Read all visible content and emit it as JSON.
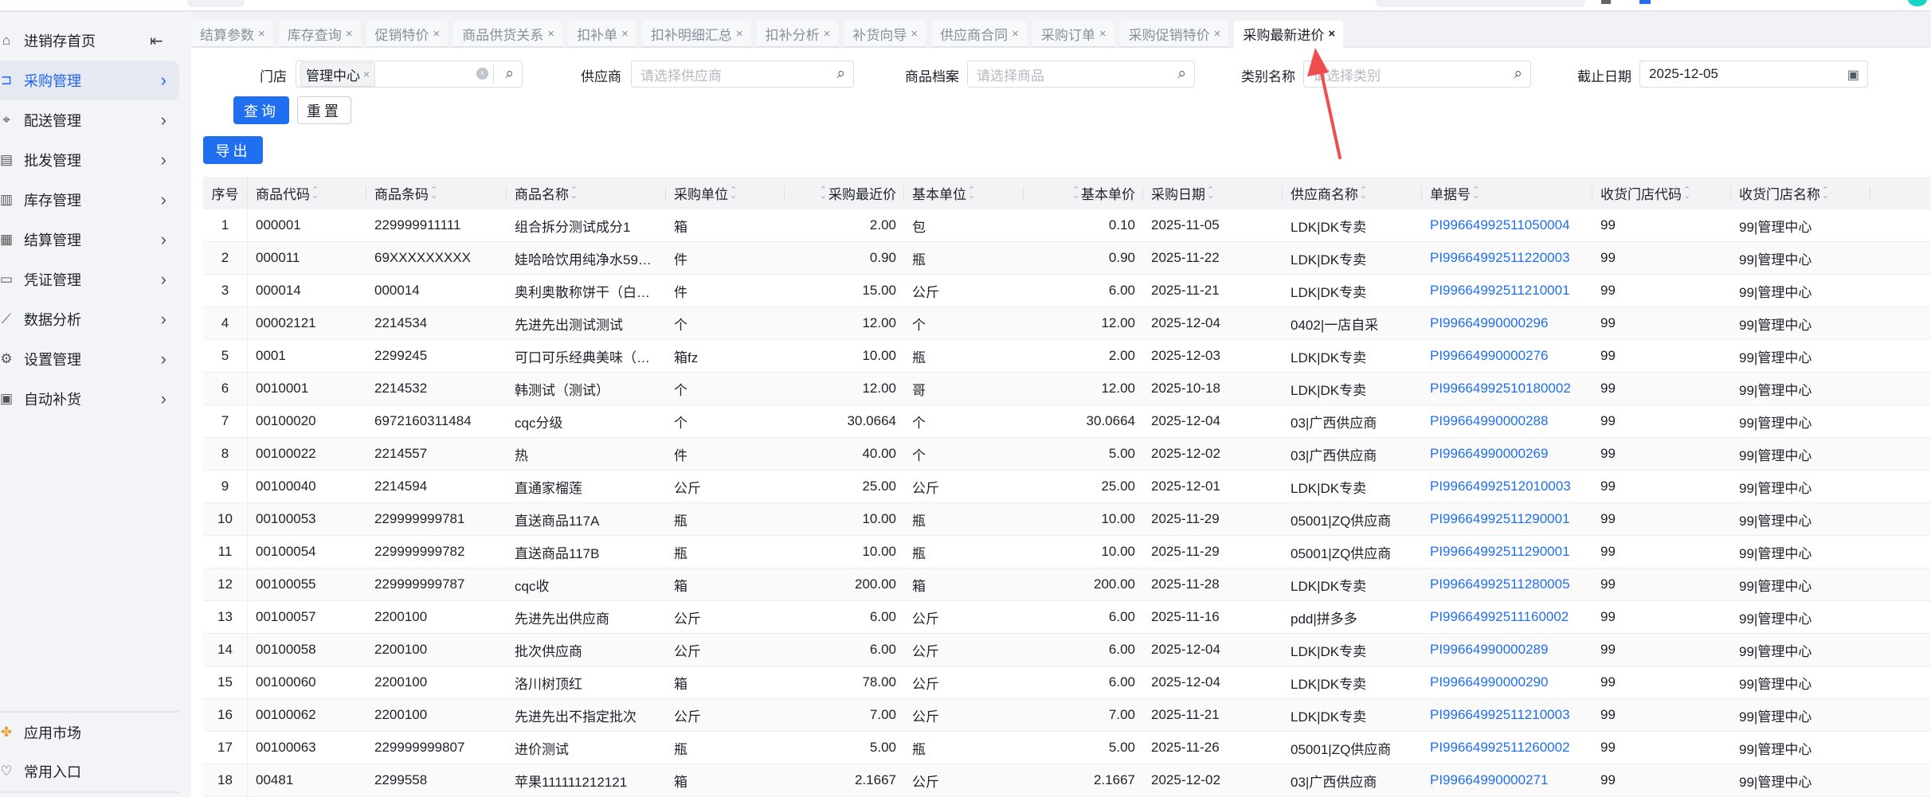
{
  "colors": {
    "accent": "#1f6ff0",
    "active_bg": "#e6e9f2",
    "link": "#1f6ff0",
    "annotation_arrow": "#f24d4d"
  },
  "sidebar": {
    "items": [
      {
        "label": "进销存首页",
        "icon": "home-icon"
      },
      {
        "label": "采购管理",
        "icon": "cart-icon",
        "active": true
      },
      {
        "label": "配送管理",
        "icon": "location-icon"
      },
      {
        "label": "批发管理",
        "icon": "box-icon"
      },
      {
        "label": "库存管理",
        "icon": "warehouse-icon"
      },
      {
        "label": "结算管理",
        "icon": "calculator-icon"
      },
      {
        "label": "凭证管理",
        "icon": "voucher-icon"
      },
      {
        "label": "数据分析",
        "icon": "chart-icon"
      },
      {
        "label": "设置管理",
        "icon": "settings-icon"
      },
      {
        "label": "自动补货",
        "icon": "refill-icon"
      }
    ],
    "bottom": [
      {
        "label": "应用市场",
        "icon": "app-market-icon"
      },
      {
        "label": "常用入口",
        "icon": "heart-icon"
      }
    ]
  },
  "tabs": [
    {
      "label": "结算参数"
    },
    {
      "label": "库存查询"
    },
    {
      "label": "促销特价"
    },
    {
      "label": "商品供货关系"
    },
    {
      "label": "扣补单"
    },
    {
      "label": "扣补明细汇总"
    },
    {
      "label": "扣补分析"
    },
    {
      "label": "补货向导"
    },
    {
      "label": "供应商合同"
    },
    {
      "label": "采购订单"
    },
    {
      "label": "采购促销特价"
    },
    {
      "label": "采购最新进价",
      "active": true
    }
  ],
  "filters": {
    "store": {
      "label": "门店",
      "chip": "管理中心"
    },
    "supplier": {
      "label": "供应商",
      "placeholder": "请选择供应商"
    },
    "product": {
      "label": "商品档案",
      "placeholder": "请选择商品"
    },
    "category": {
      "label": "类别名称",
      "placeholder": "请选择类别"
    },
    "date": {
      "label": "截止日期",
      "value": "2025-12-05"
    }
  },
  "buttons": {
    "query": "查询",
    "reset": "重置",
    "export": "导出"
  },
  "table": {
    "columns": [
      "序号",
      "商品代码",
      "商品条码",
      "商品名称",
      "采购单位",
      "采购最近价",
      "基本单位",
      "基本单价",
      "采购日期",
      "供应商名称",
      "单据号",
      "收货门店代码",
      "收货门店名称"
    ],
    "rows": [
      [
        "1",
        "000001",
        "229999911111",
        "组合拆分测试成分1",
        "箱",
        "2.00",
        "包",
        "0.10",
        "2025-11-05",
        "LDK|DK专卖",
        "PI99664992511050004",
        "99",
        "99|管理中心"
      ],
      [
        "2",
        "000011",
        "69XXXXXXXXX",
        "娃哈哈饮用纯净水59…",
        "件",
        "0.90",
        "瓶",
        "0.90",
        "2025-11-22",
        "LDK|DK专卖",
        "PI99664992511220003",
        "99",
        "99|管理中心"
      ],
      [
        "3",
        "000014",
        "000014",
        "奥利奥散称饼干（白…",
        "件",
        "15.00",
        "公斤",
        "6.00",
        "2025-11-21",
        "LDK|DK专卖",
        "PI99664992511210001",
        "99",
        "99|管理中心"
      ],
      [
        "4",
        "00002121",
        "2214534",
        "先进先出测试测试",
        "个",
        "12.00",
        "个",
        "12.00",
        "2025-12-04",
        "0402|一店自采",
        "PI99664990000296",
        "99",
        "99|管理中心"
      ],
      [
        "5",
        "0001",
        "2299245",
        "可口可乐经典美味（…",
        "箱fz",
        "10.00",
        "瓶",
        "2.00",
        "2025-12-03",
        "LDK|DK专卖",
        "PI99664990000276",
        "99",
        "99|管理中心"
      ],
      [
        "6",
        "0010001",
        "2214532",
        "韩测试（测试）",
        "个",
        "12.00",
        "哥",
        "12.00",
        "2025-10-18",
        "LDK|DK专卖",
        "PI99664992510180002",
        "99",
        "99|管理中心"
      ],
      [
        "7",
        "00100020",
        "6972160311484",
        "cqc分级",
        "个",
        "30.0664",
        "个",
        "30.0664",
        "2025-12-04",
        "03|广西供应商",
        "PI99664990000288",
        "99",
        "99|管理中心"
      ],
      [
        "8",
        "00100022",
        "2214557",
        "热",
        "件",
        "40.00",
        "个",
        "5.00",
        "2025-12-02",
        "03|广西供应商",
        "PI99664990000269",
        "99",
        "99|管理中心"
      ],
      [
        "9",
        "00100040",
        "2214594",
        "直通家榴莲",
        "公斤",
        "25.00",
        "公斤",
        "25.00",
        "2025-12-01",
        "LDK|DK专卖",
        "PI99664992512010003",
        "99",
        "99|管理中心"
      ],
      [
        "10",
        "00100053",
        "229999999781",
        "直送商品117A",
        "瓶",
        "10.00",
        "瓶",
        "10.00",
        "2025-11-29",
        "05001|ZQ供应商",
        "PI99664992511290001",
        "99",
        "99|管理中心"
      ],
      [
        "11",
        "00100054",
        "229999999782",
        "直送商品117B",
        "瓶",
        "10.00",
        "瓶",
        "10.00",
        "2025-11-29",
        "05001|ZQ供应商",
        "PI99664992511290001",
        "99",
        "99|管理中心"
      ],
      [
        "12",
        "00100055",
        "229999999787",
        "cqc收",
        "箱",
        "200.00",
        "箱",
        "200.00",
        "2025-11-28",
        "LDK|DK专卖",
        "PI99664992511280005",
        "99",
        "99|管理中心"
      ],
      [
        "13",
        "00100057",
        "2200100",
        "先进先出供应商",
        "公斤",
        "6.00",
        "公斤",
        "6.00",
        "2025-11-16",
        "pdd|拼多多",
        "PI99664992511160002",
        "99",
        "99|管理中心"
      ],
      [
        "14",
        "00100058",
        "2200100",
        "批次供应商",
        "公斤",
        "6.00",
        "公斤",
        "6.00",
        "2025-12-04",
        "LDK|DK专卖",
        "PI99664990000289",
        "99",
        "99|管理中心"
      ],
      [
        "15",
        "00100060",
        "2200100",
        "洛川树顶红",
        "箱",
        "78.00",
        "公斤",
        "6.00",
        "2025-12-04",
        "LDK|DK专卖",
        "PI99664990000290",
        "99",
        "99|管理中心"
      ],
      [
        "16",
        "00100062",
        "2200100",
        "先进先出不指定批次",
        "公斤",
        "7.00",
        "公斤",
        "7.00",
        "2025-11-21",
        "LDK|DK专卖",
        "PI99664992511210003",
        "99",
        "99|管理中心"
      ],
      [
        "17",
        "00100063",
        "229999999807",
        "进价测试",
        "瓶",
        "5.00",
        "瓶",
        "5.00",
        "2025-11-26",
        "05001|ZQ供应商",
        "PI99664992511260002",
        "99",
        "99|管理中心"
      ],
      [
        "18",
        "00481",
        "2299558",
        "苹果111111212121",
        "箱",
        "2.1667",
        "公斤",
        "2.1667",
        "2025-12-02",
        "03|广西供应商",
        "PI99664990000271",
        "99",
        "99|管理中心"
      ]
    ]
  }
}
